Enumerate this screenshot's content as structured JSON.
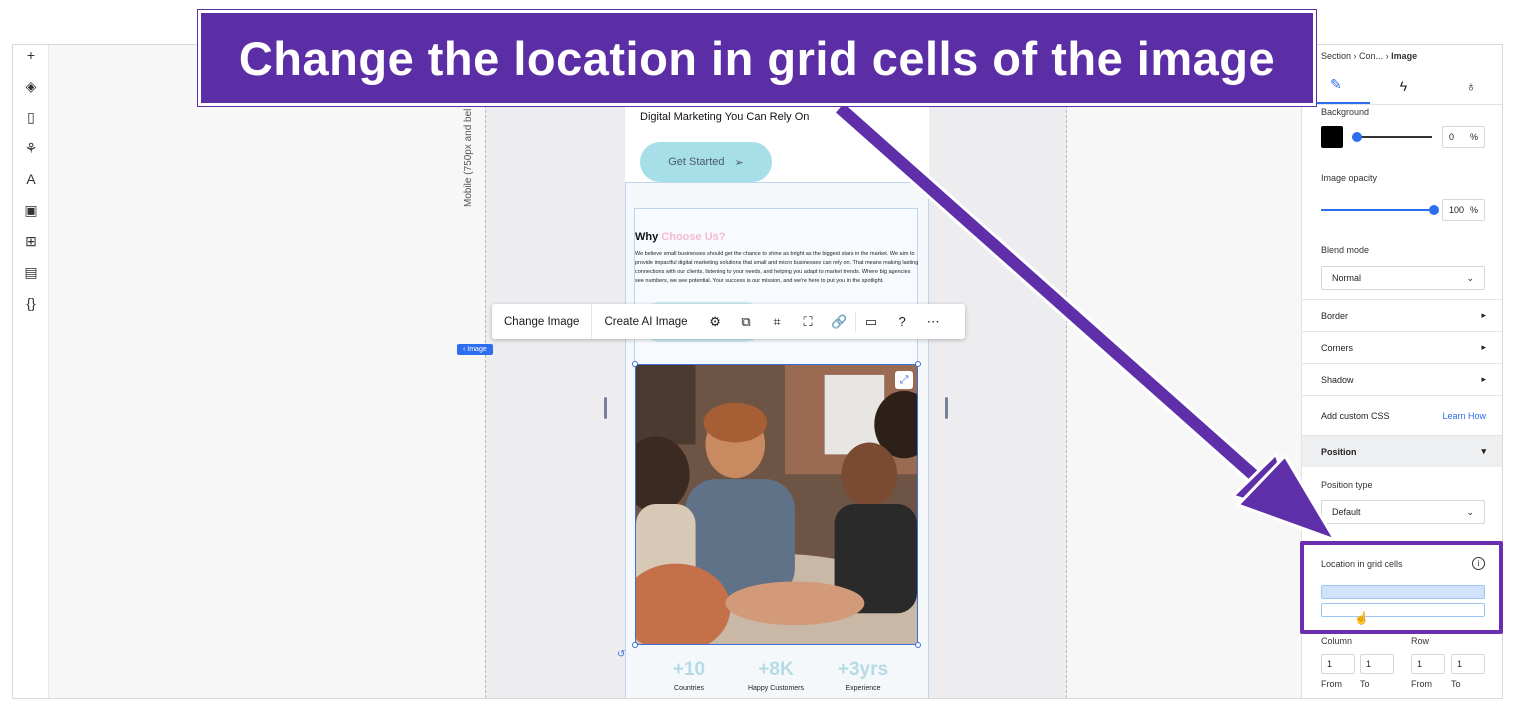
{
  "banner": {
    "text": "Change the location in grid cells of the image"
  },
  "left_rail": {
    "icons": [
      "plus-icon",
      "layers-icon",
      "page-icon",
      "components-icon",
      "typography-icon",
      "image-icon",
      "apps-icon",
      "table-icon",
      "code-icon"
    ]
  },
  "canvas": {
    "breakpoint_label": "Mobile (750px and bel",
    "page": {
      "tagline": "Digital Marketing You Can Rely On",
      "cta_label": "Get Started",
      "why_heading": "Why",
      "why_heading_highlight": "Choose Us?",
      "why_body": "We believe small businesses should get the chance to shine as bright as the biggest stars in the market. We aim to provide impactful digital marketing solutions that small and micro businesses can rely on. That means making lasting connections with our clients, listening to your needs, and helping you adapt to market trends. Where big agencies see numbers, we see potential. Your success is our mission, and we're here to put you in the spotlight.",
      "stats": [
        {
          "value": "+10",
          "label": "Countries"
        },
        {
          "value": "+8K",
          "label": "Happy Customers"
        },
        {
          "value": "+3yrs",
          "label": "Experience"
        }
      ]
    },
    "element_chip": "‹ Image",
    "toolbar": {
      "change_image": "Change Image",
      "create_ai_image": "Create AI Image",
      "icons": [
        "settings-icon",
        "mask-icon",
        "crop-icon",
        "focus-icon",
        "link-icon",
        "comment-icon",
        "help-icon",
        "more-icon"
      ]
    }
  },
  "inspector": {
    "breadcrumb": {
      "part1": "Section",
      "part2": "Con...",
      "current": "Image"
    },
    "tabs": [
      "design-tab",
      "interactions-tab",
      "ideas-tab"
    ],
    "background_label": "Background",
    "background_color": "#000000",
    "background_opacity_value": "0",
    "percent": "%",
    "image_opacity_label": "Image opacity",
    "image_opacity_value": "100",
    "blend_mode_label": "Blend mode",
    "blend_mode_value": "Normal",
    "border_label": "Border",
    "corners_label": "Corners",
    "shadow_label": "Shadow",
    "custom_css_label": "Add custom CSS",
    "learn_how": "Learn How",
    "position_label": "Position",
    "position_type_label": "Position type",
    "position_type_value": "Default",
    "location_grid_label": "Location in grid cells",
    "column_label": "Column",
    "row_label": "Row",
    "column_from": "1",
    "column_to": "1",
    "row_from": "1",
    "row_to": "1",
    "from_label": "From",
    "to_label": "To"
  }
}
